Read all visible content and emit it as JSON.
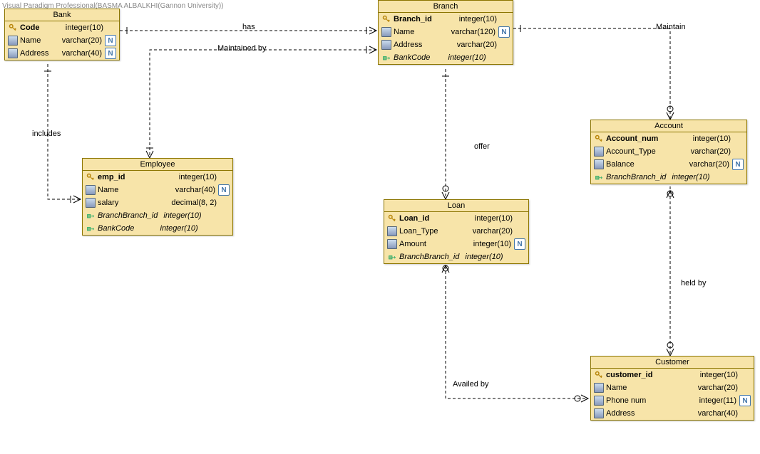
{
  "watermark": "Visual Paradigm Professional(BASMA ALBALKHI(Gannon University))",
  "entities": {
    "bank": {
      "title": "Bank",
      "cols": [
        {
          "icon": "key",
          "name": "Code",
          "type": "integer(10)",
          "pk": true,
          "null": false
        },
        {
          "icon": "col",
          "name": "Name",
          "type": "varchar(20)",
          "null": true
        },
        {
          "icon": "col",
          "name": "Address",
          "type": "varchar(40)",
          "null": true
        }
      ]
    },
    "branch": {
      "title": "Branch",
      "cols": [
        {
          "icon": "key",
          "name": "Branch_id",
          "type": "integer(10)",
          "pk": true,
          "null": false
        },
        {
          "icon": "col",
          "name": "Name",
          "type": "varchar(120)",
          "null": true
        },
        {
          "icon": "col",
          "name": "Address",
          "type": "varchar(20)",
          "null": false
        },
        {
          "icon": "fk",
          "name": "BankCode",
          "type": "integer(10)",
          "fk": true,
          "null": false
        }
      ]
    },
    "employee": {
      "title": "Employee",
      "cols": [
        {
          "icon": "key",
          "name": "emp_id",
          "type": "integer(10)",
          "pk": true,
          "null": false
        },
        {
          "icon": "col",
          "name": "Name",
          "type": "varchar(40)",
          "null": true
        },
        {
          "icon": "col",
          "name": "salary",
          "type": "decimal(8, 2)",
          "null": false
        },
        {
          "icon": "fk",
          "name": "BranchBranch_id",
          "type": "integer(10)",
          "fk": true,
          "null": false
        },
        {
          "icon": "fk",
          "name": "BankCode",
          "type": "integer(10)",
          "fk": true,
          "null": false
        }
      ]
    },
    "account": {
      "title": "Account",
      "cols": [
        {
          "icon": "key",
          "name": "Account_num",
          "type": "integer(10)",
          "pk": true,
          "null": false
        },
        {
          "icon": "col",
          "name": "Account_Type",
          "type": "varchar(20)",
          "null": false
        },
        {
          "icon": "col",
          "name": "Balance",
          "type": "varchar(20)",
          "null": true
        },
        {
          "icon": "fk",
          "name": "BranchBranch_id",
          "type": "integer(10)",
          "fk": true,
          "null": false
        }
      ]
    },
    "loan": {
      "title": "Loan",
      "cols": [
        {
          "icon": "key",
          "name": "Loan_id",
          "type": "integer(10)",
          "pk": true,
          "null": false
        },
        {
          "icon": "col",
          "name": "Loan_Type",
          "type": "varchar(20)",
          "null": false
        },
        {
          "icon": "col",
          "name": "Amount",
          "type": "integer(10)",
          "null": true
        },
        {
          "icon": "fk",
          "name": "BranchBranch_id",
          "type": "integer(10)",
          "fk": true,
          "null": false
        }
      ]
    },
    "customer": {
      "title": "Customer",
      "cols": [
        {
          "icon": "key",
          "name": "customer_id",
          "type": "integer(10)",
          "pk": true,
          "null": false
        },
        {
          "icon": "col",
          "name": "Name",
          "type": "varchar(20)",
          "null": false
        },
        {
          "icon": "col",
          "name": "Phone num",
          "type": "integer(11)",
          "null": true
        },
        {
          "icon": "col",
          "name": "Address",
          "type": "varchar(40)",
          "null": false
        }
      ]
    }
  },
  "labels": {
    "has": "has",
    "maintained_by": "Maintained by",
    "includes": "includes",
    "offer": "offer",
    "maintain": "Maintain",
    "held_by": "held by",
    "availed_by": "Availed by"
  }
}
